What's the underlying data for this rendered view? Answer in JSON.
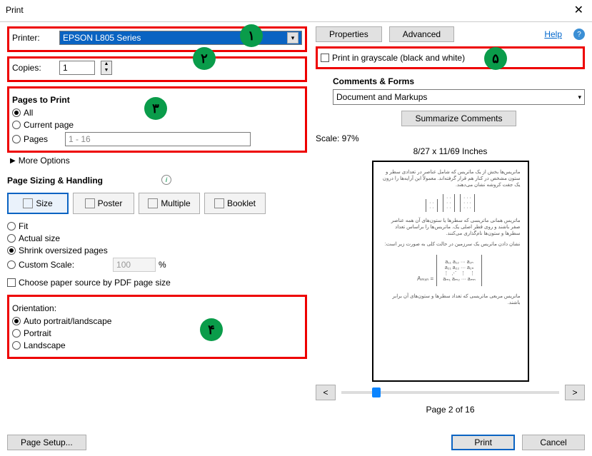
{
  "window": {
    "title": "Print",
    "close": "✕"
  },
  "top_left": {
    "printer_label": "Printer:",
    "printer_value": "EPSON L805 Series",
    "copies_label": "Copies:",
    "copies_value": "1"
  },
  "top_right": {
    "properties": "Properties",
    "advanced": "Advanced",
    "grayscale": "Print in grayscale (black and white)",
    "help": "Help",
    "help_q": "?"
  },
  "pages": {
    "header": "Pages to Print",
    "all": "All",
    "current": "Current page",
    "pages": "Pages",
    "range": "1 - 16",
    "more": "More Options"
  },
  "sizing": {
    "header": "Page Sizing & Handling",
    "size": "Size",
    "poster": "Poster",
    "multiple": "Multiple",
    "booklet": "Booklet",
    "fit": "Fit",
    "actual": "Actual size",
    "shrink": "Shrink oversized pages",
    "custom": "Custom Scale:",
    "custom_val": "100",
    "pct": "%",
    "choose": "Choose paper source by PDF page size"
  },
  "orientation": {
    "header": "Orientation:",
    "auto": "Auto portrait/landscape",
    "portrait": "Portrait",
    "landscape": "Landscape"
  },
  "comments": {
    "header": "Comments & Forms",
    "value": "Document and Markups",
    "summarize": "Summarize Comments"
  },
  "preview": {
    "scale": "Scale:  97%",
    "dims": "8/27 x 11/69 Inches",
    "page": "Page 2 of 16"
  },
  "footer": {
    "page_setup": "Page Setup...",
    "print": "Print",
    "cancel": "Cancel"
  },
  "badges": {
    "b1": "١",
    "b2": "٢",
    "b3": "٣",
    "b4": "۴",
    "b5": "۵"
  }
}
